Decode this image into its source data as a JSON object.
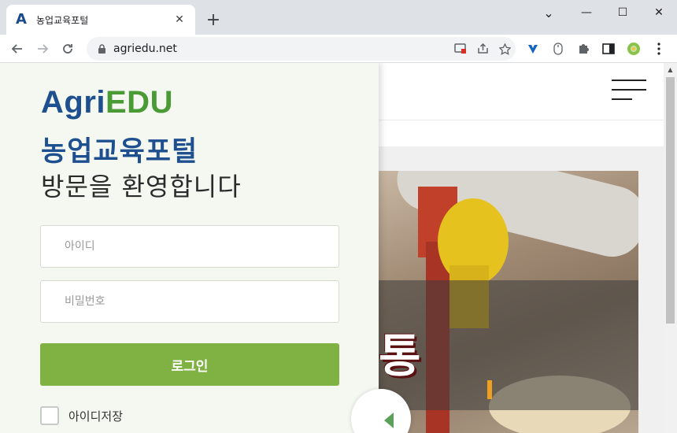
{
  "browser": {
    "tab_title": "농업교육포털",
    "tab_favicon": "A",
    "url": "agriedu.net",
    "new_tab": "+",
    "close_tab": "✕",
    "window_controls": {
      "minimize": "—",
      "maximize": "☐",
      "close": "✕",
      "tab_search": "⌄"
    }
  },
  "icons": {
    "back": "back-arrow-icon",
    "forward": "forward-arrow-icon",
    "reload": "reload-icon",
    "lock": "lock-icon",
    "install": "install-app-icon",
    "share": "share-icon",
    "bookmark": "star-icon",
    "extensions": [
      "vee-extension-icon",
      "mouse-extension-icon",
      "puzzle-extensions-icon",
      "side-panel-icon",
      "profile-icon",
      "menu-dots-icon"
    ]
  },
  "login": {
    "logo_agri": "Agri",
    "logo_edu": "EDU",
    "portal_title": "농업교육포털",
    "welcome": "방문을 환영합니다",
    "id_placeholder": "아이디",
    "pw_placeholder": "비밀번호",
    "login_button": "로그인",
    "remember_label": "아이디저장"
  },
  "site": {
    "hero_text": "통"
  },
  "colors": {
    "brand_blue": "#1e4f8f",
    "brand_green": "#4a9a35",
    "login_button": "#80b243",
    "panel_bg": "#f5f8f1"
  }
}
